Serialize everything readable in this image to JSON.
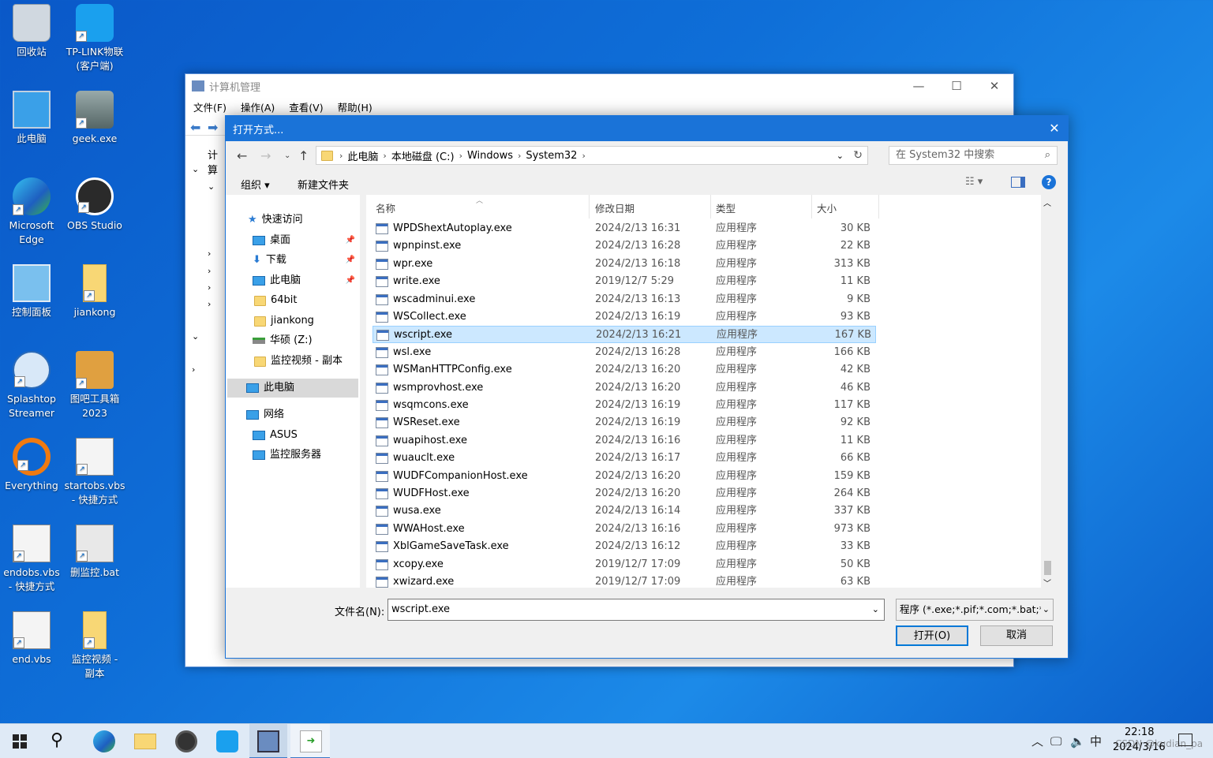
{
  "desktop": {
    "icons": [
      {
        "label": "回收站",
        "icon": "recycle-bin-icon"
      },
      {
        "label": "TP-LINK物联\n(客户端)",
        "icon": "tp-link-icon"
      },
      {
        "label": "此电脑",
        "icon": "this-pc-icon"
      },
      {
        "label": "geek.exe",
        "icon": "geek-icon"
      },
      {
        "label": "Microsoft\nEdge",
        "icon": "edge-icon"
      },
      {
        "label": "OBS Studio",
        "icon": "obs-icon"
      },
      {
        "label": "控制面板",
        "icon": "control-panel-icon"
      },
      {
        "label": "jiankong",
        "icon": "folder-icon"
      },
      {
        "label": "Splashtop\nStreamer",
        "icon": "splashtop-icon"
      },
      {
        "label": "图吧工具箱\n2023",
        "icon": "toolbox-icon"
      },
      {
        "label": "Everything",
        "icon": "everything-icon"
      },
      {
        "label": "startobs.vbs\n- 快捷方式",
        "icon": "vbs-icon"
      },
      {
        "label": "endobs.vbs\n- 快捷方式",
        "icon": "vbs-icon"
      },
      {
        "label": "删监控.bat",
        "icon": "bat-icon"
      },
      {
        "label": "end.vbs",
        "icon": "vbs-icon"
      },
      {
        "label": "监控视频 -\n副本",
        "icon": "folder-icon"
      }
    ]
  },
  "cm_window": {
    "title": "计算机管理",
    "menu": [
      "文件(F)",
      "操作(A)",
      "查看(V)",
      "帮助(H)"
    ],
    "tree_label": "计算"
  },
  "dialog": {
    "title": "打开方式...",
    "breadcrumb": [
      "此电脑",
      "本地磁盘 (C:)",
      "Windows",
      "System32"
    ],
    "search_placeholder": "在 System32 中搜索",
    "organize": "组织 ▾",
    "new_folder": "新建文件夹",
    "nav": {
      "quick_access": "快速访问",
      "items": [
        "桌面",
        "下载",
        "此电脑",
        "64bit",
        "jiankong",
        "华硕 (Z:)",
        "监控视频 - 副本"
      ],
      "this_pc": "此电脑",
      "network": "网络",
      "net_items": [
        "ASUS",
        "监控服务器"
      ]
    },
    "columns": {
      "name": "名称",
      "date": "修改日期",
      "type": "类型",
      "size": "大小"
    },
    "files": [
      {
        "name": "WPDShextAutoplay.exe",
        "date": "2024/2/13 16:31",
        "type": "应用程序",
        "size": "30 KB"
      },
      {
        "name": "wpnpinst.exe",
        "date": "2024/2/13 16:28",
        "type": "应用程序",
        "size": "22 KB"
      },
      {
        "name": "wpr.exe",
        "date": "2024/2/13 16:18",
        "type": "应用程序",
        "size": "313 KB"
      },
      {
        "name": "write.exe",
        "date": "2019/12/7 5:29",
        "type": "应用程序",
        "size": "11 KB"
      },
      {
        "name": "wscadminui.exe",
        "date": "2024/2/13 16:13",
        "type": "应用程序",
        "size": "9 KB"
      },
      {
        "name": "WSCollect.exe",
        "date": "2024/2/13 16:19",
        "type": "应用程序",
        "size": "93 KB"
      },
      {
        "name": "wscript.exe",
        "date": "2024/2/13 16:21",
        "type": "应用程序",
        "size": "167 KB",
        "selected": true
      },
      {
        "name": "wsl.exe",
        "date": "2024/2/13 16:28",
        "type": "应用程序",
        "size": "166 KB"
      },
      {
        "name": "WSManHTTPConfig.exe",
        "date": "2024/2/13 16:20",
        "type": "应用程序",
        "size": "42 KB"
      },
      {
        "name": "wsmprovhost.exe",
        "date": "2024/2/13 16:20",
        "type": "应用程序",
        "size": "46 KB"
      },
      {
        "name": "wsqmcons.exe",
        "date": "2024/2/13 16:19",
        "type": "应用程序",
        "size": "117 KB"
      },
      {
        "name": "WSReset.exe",
        "date": "2024/2/13 16:19",
        "type": "应用程序",
        "size": "92 KB"
      },
      {
        "name": "wuapihost.exe",
        "date": "2024/2/13 16:16",
        "type": "应用程序",
        "size": "11 KB"
      },
      {
        "name": "wuauclt.exe",
        "date": "2024/2/13 16:17",
        "type": "应用程序",
        "size": "66 KB"
      },
      {
        "name": "WUDFCompanionHost.exe",
        "date": "2024/2/13 16:20",
        "type": "应用程序",
        "size": "159 KB"
      },
      {
        "name": "WUDFHost.exe",
        "date": "2024/2/13 16:20",
        "type": "应用程序",
        "size": "264 KB"
      },
      {
        "name": "wusa.exe",
        "date": "2024/2/13 16:14",
        "type": "应用程序",
        "size": "337 KB"
      },
      {
        "name": "WWAHost.exe",
        "date": "2024/2/13 16:16",
        "type": "应用程序",
        "size": "973 KB"
      },
      {
        "name": "XblGameSaveTask.exe",
        "date": "2024/2/13 16:12",
        "type": "应用程序",
        "size": "33 KB"
      },
      {
        "name": "xcopy.exe",
        "date": "2019/12/7 17:09",
        "type": "应用程序",
        "size": "50 KB"
      },
      {
        "name": "xwizard.exe",
        "date": "2019/12/7 17:09",
        "type": "应用程序",
        "size": "63 KB"
      }
    ],
    "filename_label": "文件名(N):",
    "filename_value": "wscript.exe",
    "filetype": "程序 (*.exe;*.pif;*.com;*.bat;*.",
    "open_button": "打开(O)",
    "cancel_button": "取消"
  },
  "taskbar": {
    "ime": "中",
    "time": "22:18",
    "date": "2024/3/16",
    "watermark": "CSDN @kudian_pa"
  }
}
